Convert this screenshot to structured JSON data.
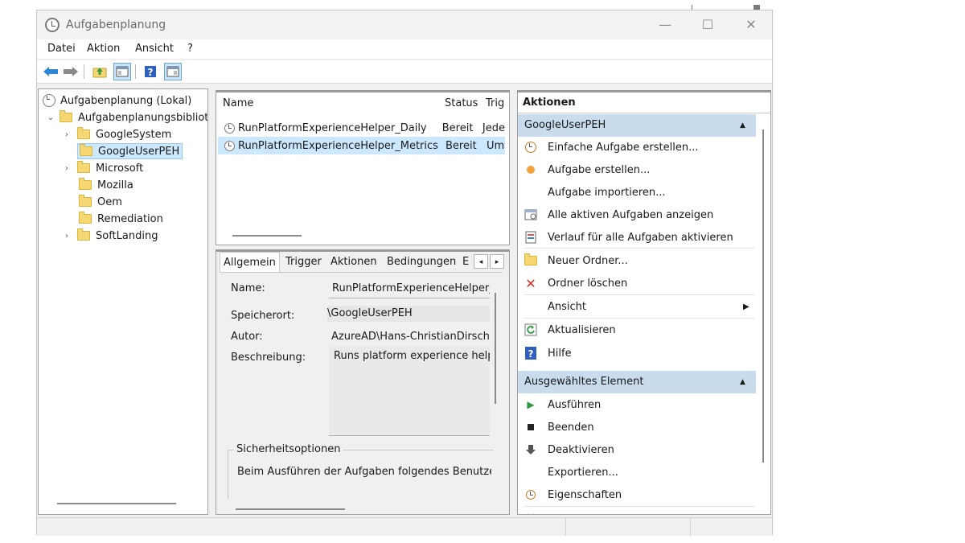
{
  "window": {
    "title": "Aufgabenplanung",
    "minimize": "—",
    "maximize": "☐",
    "close": "✕"
  },
  "menu": {
    "items": [
      "Datei",
      "Aktion",
      "Ansicht",
      "?"
    ]
  },
  "tree": {
    "root": "Aufgabenplanung (Lokal)",
    "library": "Aufgabenplanungsbibliot",
    "folders": [
      {
        "label": "GoogleSystem",
        "expandable": true,
        "selected": false
      },
      {
        "label": "GoogleUserPEH",
        "expandable": false,
        "selected": true
      },
      {
        "label": "Microsoft",
        "expandable": true,
        "selected": false
      },
      {
        "label": "Mozilla",
        "expandable": false,
        "selected": false
      },
      {
        "label": "Oem",
        "expandable": false,
        "selected": false
      },
      {
        "label": "Remediation",
        "expandable": false,
        "selected": false
      },
      {
        "label": "SoftLanding",
        "expandable": true,
        "selected": false
      }
    ]
  },
  "task_list": {
    "columns": [
      "Name",
      "Status",
      "Trig"
    ],
    "rows": [
      {
        "name": "RunPlatformExperienceHelper_Daily",
        "status": "Bereit",
        "trigger": "Jede",
        "selected": false
      },
      {
        "name": "RunPlatformExperienceHelper_Metrics",
        "status": "Bereit",
        "trigger": "Um",
        "selected": true
      }
    ]
  },
  "details": {
    "tabs": [
      "Allgemein",
      "Trigger",
      "Aktionen",
      "Bedingungen",
      "E"
    ],
    "labels": {
      "name": "Name:",
      "location": "Speicherort:",
      "author": "Autor:",
      "description": "Beschreibung:"
    },
    "values": {
      "name": "RunPlatformExperienceHelper_M",
      "location": "\\GoogleUserPEH",
      "author": "AzureAD\\Hans-ChristianDirsch",
      "description": "Runs platform experience helpe"
    },
    "security_title": "Sicherheitsoptionen",
    "security_text": "Beim Ausführen der Aufgaben folgendes Benutzerk"
  },
  "actions": {
    "title": "Aktionen",
    "section1": {
      "title": "GoogleUserPEH",
      "items": [
        {
          "label": "Einfache Aufgabe erstellen...",
          "icon": "wizard-icon"
        },
        {
          "label": "Aufgabe erstellen...",
          "icon": "create-task-icon"
        },
        {
          "label": "Aufgabe importieren...",
          "icon": ""
        },
        {
          "label": "Alle aktiven Aufgaben anzeigen",
          "icon": "active-tasks-icon"
        },
        {
          "label": "Verlauf für alle Aufgaben aktivieren",
          "icon": "history-icon"
        },
        {
          "label": "Neuer Ordner...",
          "icon": "new-folder-icon"
        },
        {
          "label": "Ordner löschen",
          "icon": "delete-icon"
        },
        {
          "label": "Ansicht",
          "icon": ""
        },
        {
          "label": "Aktualisieren",
          "icon": "refresh-icon"
        },
        {
          "label": "Hilfe",
          "icon": "help-icon"
        }
      ]
    },
    "section2": {
      "title": "Ausgewähltes Element",
      "items": [
        {
          "label": "Ausführen",
          "icon": "play-icon"
        },
        {
          "label": "Beenden",
          "icon": "stop-icon"
        },
        {
          "label": "Deaktivieren",
          "icon": "disable-icon"
        },
        {
          "label": "Exportieren...",
          "icon": ""
        },
        {
          "label": "Eigenschaften",
          "icon": "properties-icon"
        }
      ]
    }
  },
  "colors": {
    "selection": "#cce8ff",
    "section_header": "#c9dced",
    "folder": "#f5d774"
  }
}
